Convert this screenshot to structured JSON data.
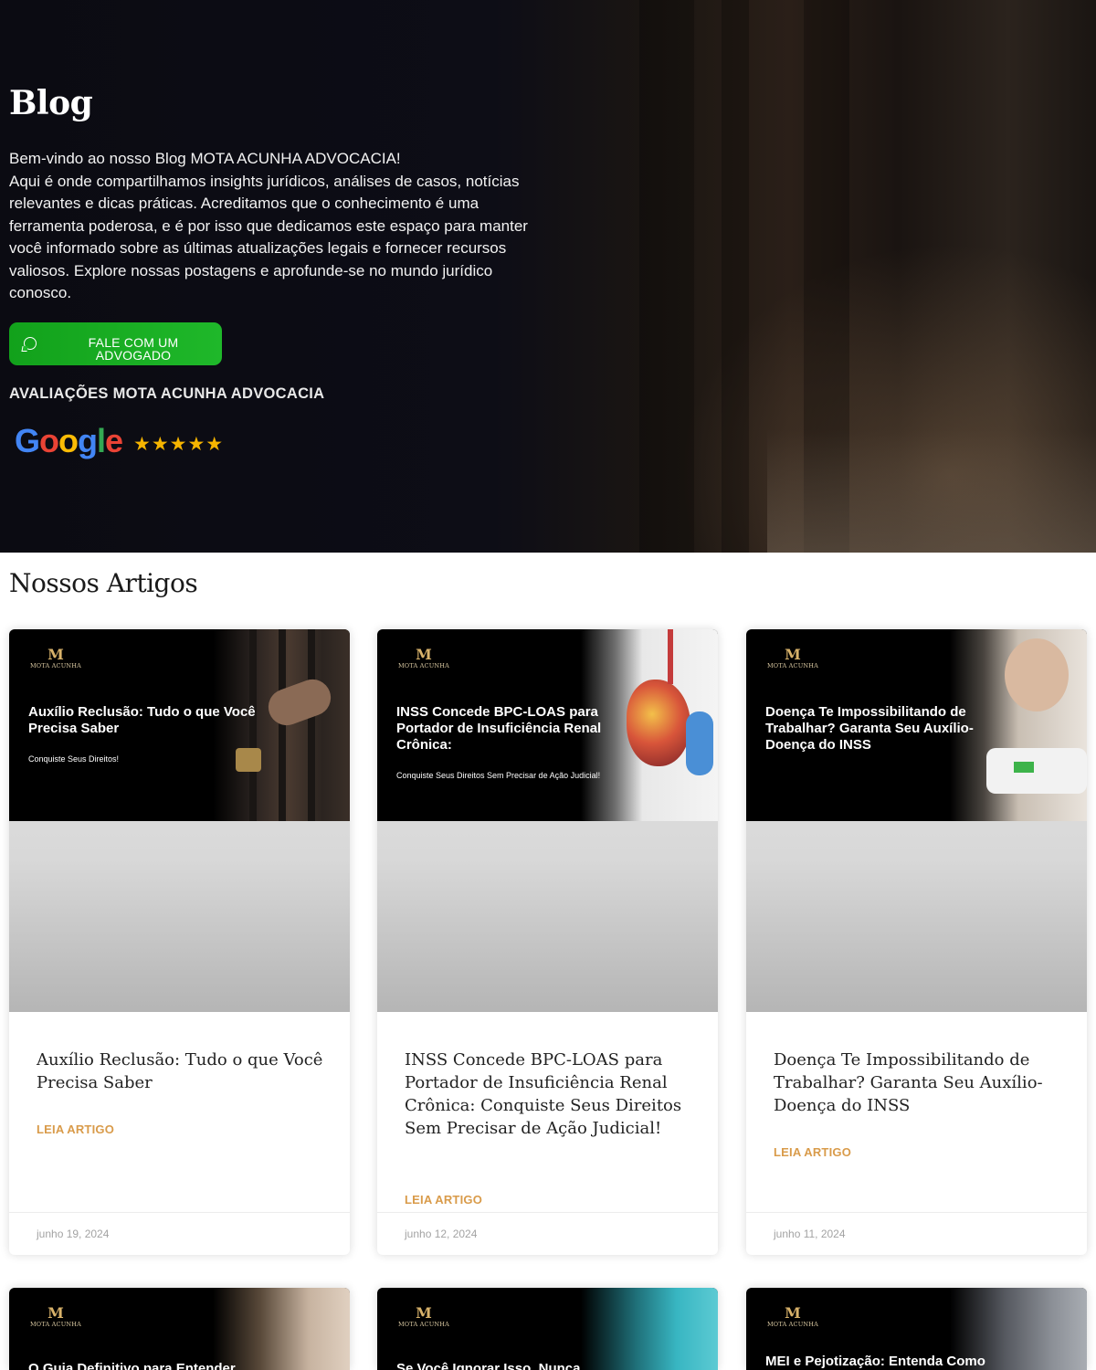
{
  "hero": {
    "title": "Blog",
    "intro_line1": "Bem-vindo ao nosso Blog MOTA ACUNHA ADVOCACIA!",
    "intro_rest": "Aqui é onde compartilhamos insights jurídicos, análises de casos, notícias relevantes e dicas práticas. Acreditamos que o conhecimento é uma ferramenta poderosa, e é por isso que dedicamos este espaço para manter você informado sobre as últimas atualizações legais e fornecer recursos valiosos. Explore nossas postagens e aprofunde-se no mundo jurídico conosco.",
    "cta_label": "FALE COM UM ADVOGADO",
    "cta_icon": "whatsapp-icon",
    "reviews_title": "AVALIAÇÕES MOTA ACUNHA ADVOCACIA",
    "google_logo": "Google",
    "stars": "★★★★★",
    "rating": 5
  },
  "section": {
    "title": "Nossos Artigos"
  },
  "brand": {
    "mark": "M",
    "name": "MOTA ACUNHA"
  },
  "articles": [
    {
      "banner_title": "Auxílio Reclusão: Tudo o que Você Precisa Saber",
      "banner_sub": "Conquiste Seus Direitos!",
      "title": "Auxílio Reclusão: Tudo o que Você Precisa Saber",
      "read_more": "LEIA ARTIGO",
      "date": "junho 19, 2024"
    },
    {
      "banner_title": "INSS Concede BPC-LOAS para Portador de Insuficiência Renal Crônica:",
      "banner_sub": "Conquiste Seus Direitos Sem Precisar de Ação Judicial!",
      "title": "INSS Concede BPC-LOAS para Portador de Insuficiência Renal Crônica: Conquiste Seus Direitos Sem Precisar de Ação Judicial!",
      "read_more": "LEIA ARTIGO",
      "date": "junho 12, 2024"
    },
    {
      "banner_title": "Doença Te Impossibilitando de Trabalhar? Garanta Seu Auxílio-Doença do INSS",
      "banner_sub": "",
      "title": "Doença Te Impossibilitando de Trabalhar? Garanta Seu Auxílio-Doença do INSS",
      "read_more": "LEIA ARTIGO",
      "date": "junho 11, 2024"
    },
    {
      "banner_title": "O Guia Definitivo para Entender"
    },
    {
      "banner_title": "Se Você Ignorar Isso, Nunca"
    },
    {
      "banner_title": "MEI e Pejotização: Entenda Como"
    }
  ],
  "colors": {
    "accent": "#d99b4a",
    "cta": "#1fb82a",
    "star": "#f5b400"
  }
}
